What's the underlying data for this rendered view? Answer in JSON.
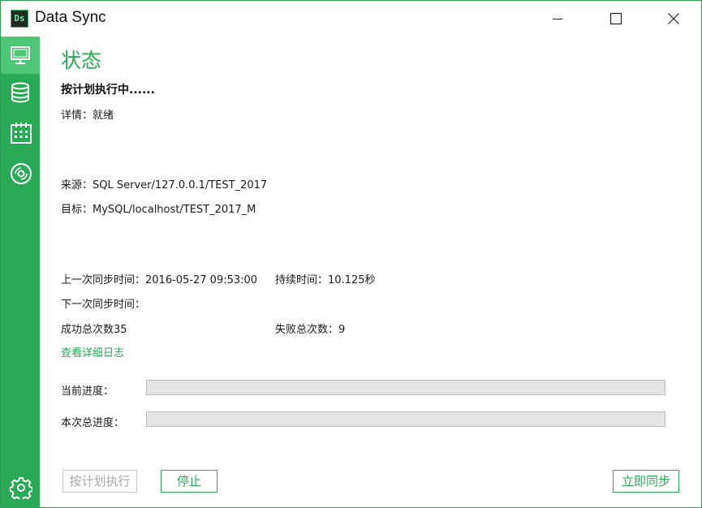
{
  "window": {
    "logo_text": "Ds",
    "title": "Data Sync"
  },
  "sidebar": {
    "items": [
      {
        "icon": "monitor-icon",
        "active": true
      },
      {
        "icon": "database-icon",
        "active": false
      },
      {
        "icon": "calendar-icon",
        "active": false
      },
      {
        "icon": "disc-icon",
        "active": false
      }
    ],
    "settings_icon": "gear-icon"
  },
  "status": {
    "title": "状态",
    "state": "按计划执行中......",
    "detail": "详情：就绪",
    "source": "来源：SQL Server/127.0.0.1/TEST_2017",
    "target": "目标：MySQL/localhost/TEST_2017_M",
    "last_sync": "上一次同步时间：2016-05-27 09:53:00",
    "duration": "持续时间：10.125秒",
    "next_sync": "下一次同步时间：",
    "success_count": "成功总次数35",
    "fail_count": "失败总次数：9",
    "log_link": "查看详细日志"
  },
  "progress": {
    "current_label": "当前进度：",
    "current_value": 0,
    "total_label": "本次总进度：",
    "total_value": 0
  },
  "buttons": {
    "schedule": "按计划执行",
    "stop": "停止",
    "sync_now": "立即同步"
  },
  "colors": {
    "accent": "#2aaa55",
    "sidebar_active": "#4fc576",
    "disabled_text": "#a8a8a8"
  }
}
